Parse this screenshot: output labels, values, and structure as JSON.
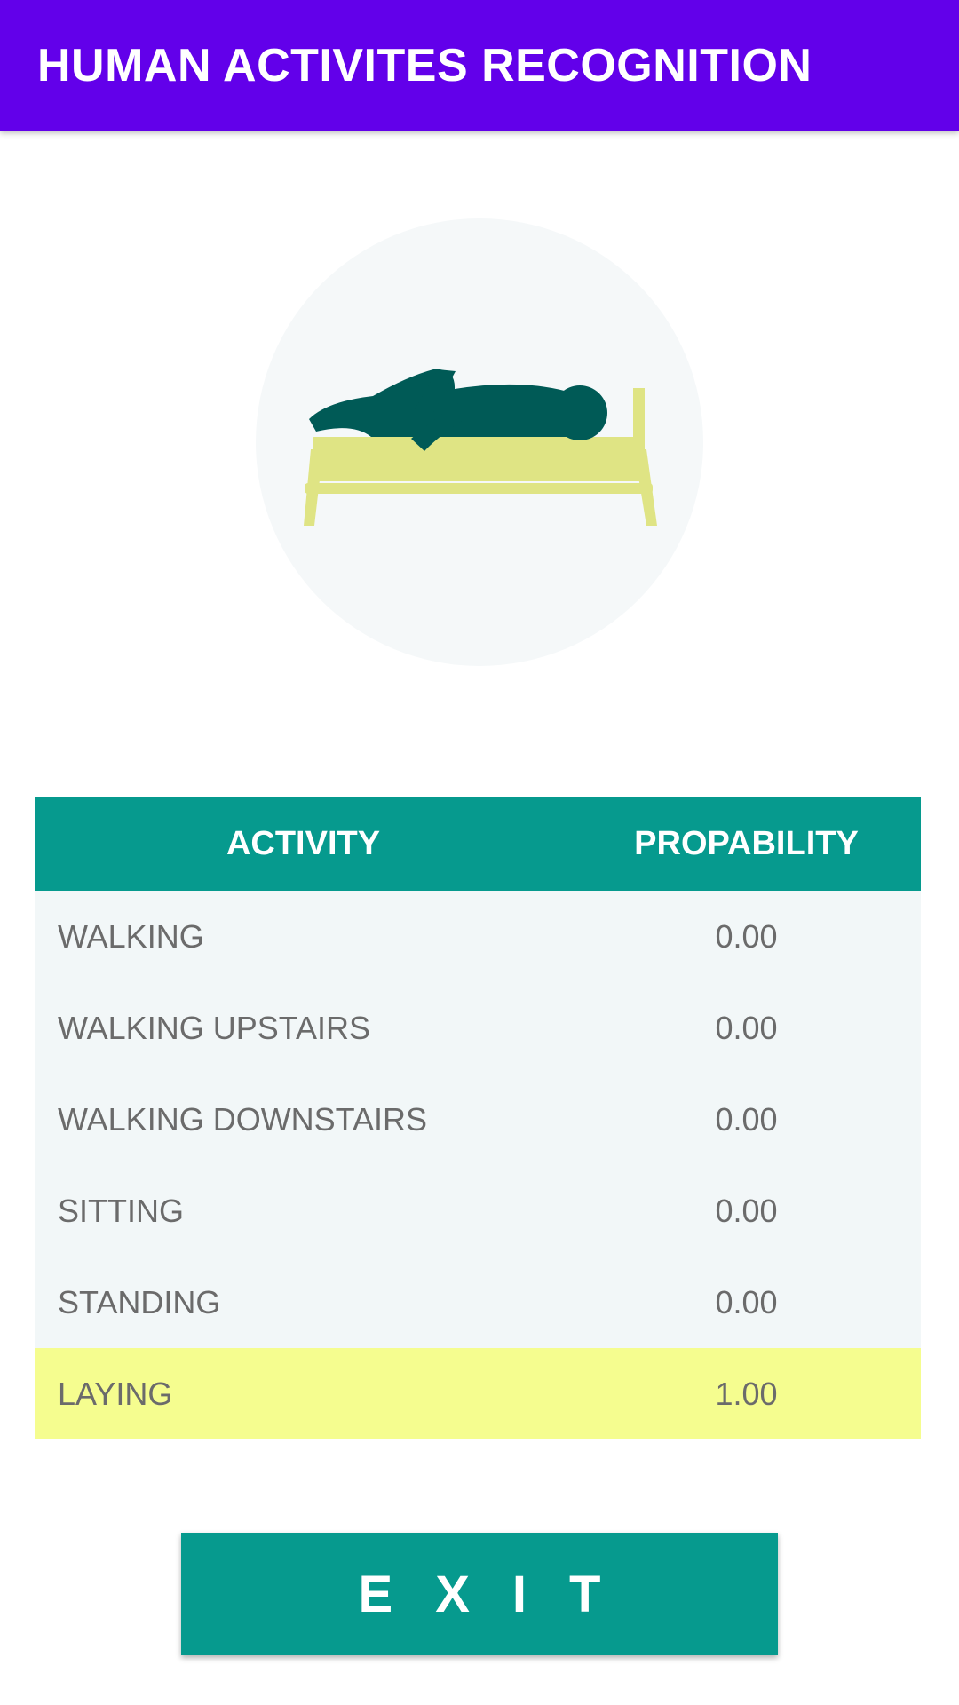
{
  "appbar": {
    "title": "HUMAN ACTIVITES RECOGNITION"
  },
  "illustration": {
    "icon": "person-laying-on-bed-icon"
  },
  "table": {
    "headers": {
      "activity": "ACTIVITY",
      "probability": "PROPABILITY"
    },
    "rows": [
      {
        "activity": "WALKING",
        "probability": "0.00"
      },
      {
        "activity": "WALKING UPSTAIRS",
        "probability": "0.00"
      },
      {
        "activity": "WALKING DOWNSTAIRS",
        "probability": "0.00"
      },
      {
        "activity": "SITTING",
        "probability": "0.00"
      },
      {
        "activity": "STANDING",
        "probability": "0.00"
      },
      {
        "activity": "LAYING",
        "probability": "1.00"
      }
    ]
  },
  "exit_button": {
    "label": "EXIT"
  },
  "colors": {
    "appbar": "#6200ea",
    "accent": "#069a8e",
    "highlight_row": "#f5fd8f",
    "row_background": "#f2f7f8",
    "bed": "#dfe484",
    "person": "#005a56"
  }
}
